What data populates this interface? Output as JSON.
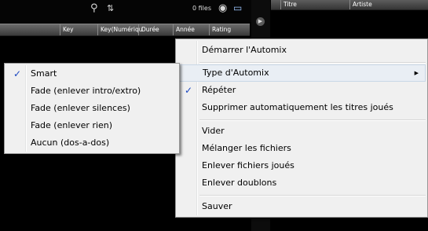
{
  "toolbar": {
    "files_count": "0 files",
    "search_icon": "search-icon",
    "filter_icon": "filter-icon",
    "eye_icon": "view-icon",
    "monitor_icon": "monitor-icon"
  },
  "columns": [
    "Key",
    "Key(Numériqu",
    "Durée",
    "Année",
    "Rating"
  ],
  "right_columns": [
    "Titre",
    "Artiste"
  ],
  "main_menu": {
    "items": [
      {
        "label": "Démarrer l'Automix",
        "checked": false,
        "submenu": false
      },
      {
        "label": "Type d'Automix",
        "checked": false,
        "submenu": true
      },
      {
        "label": "Répéter",
        "checked": true,
        "submenu": false
      },
      {
        "label": "Supprimer automatiquement les titres joués",
        "checked": false,
        "submenu": false
      },
      {
        "label": "Vider",
        "checked": false,
        "submenu": false
      },
      {
        "label": "Mélanger les fichiers",
        "checked": false,
        "submenu": false
      },
      {
        "label": "Enlever fichiers joués",
        "checked": false,
        "submenu": false
      },
      {
        "label": "Enlever doublons",
        "checked": false,
        "submenu": false
      },
      {
        "label": "Sauver",
        "checked": false,
        "submenu": false
      }
    ]
  },
  "sub_menu": {
    "items": [
      {
        "label": "Smart",
        "checked": true
      },
      {
        "label": "Fade (enlever intro/extro)",
        "checked": false
      },
      {
        "label": "Fade (enlever silences)",
        "checked": false
      },
      {
        "label": "Fade (enlever rien)",
        "checked": false
      },
      {
        "label": "Aucun (dos-a-dos)",
        "checked": false
      }
    ]
  },
  "colors": {
    "menu_bg": "#f0f0f0",
    "check": "#1a46c0",
    "highlight": "#e9eef4"
  }
}
